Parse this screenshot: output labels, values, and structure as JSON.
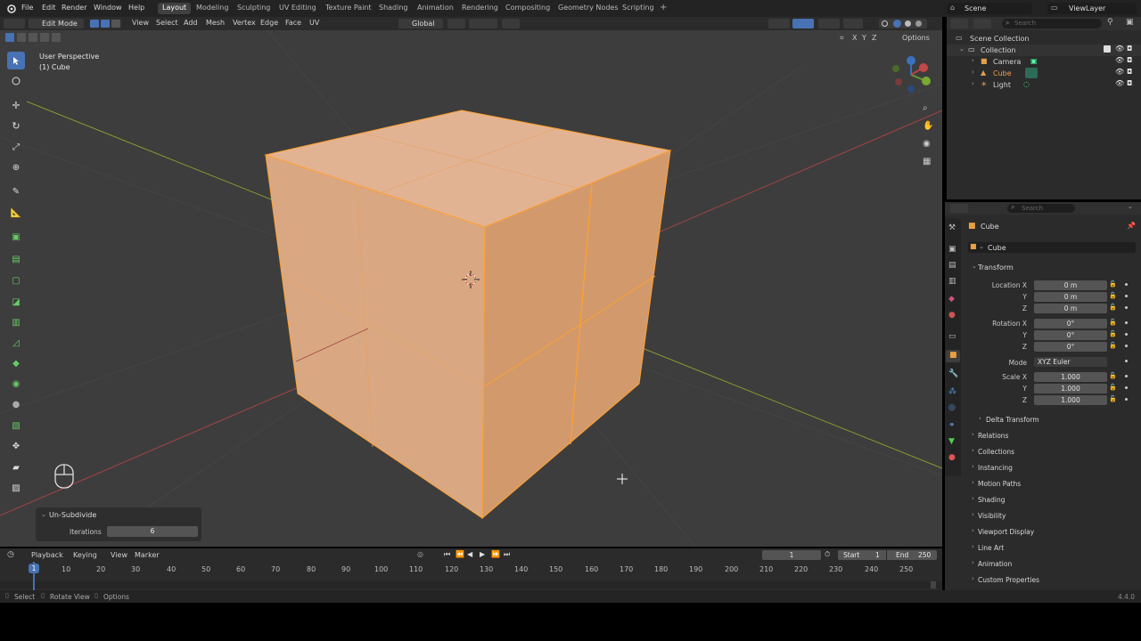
{
  "topbar": {
    "menus": [
      "File",
      "Edit",
      "Render",
      "Window",
      "Help"
    ],
    "workspaces": [
      "Layout",
      "Modeling",
      "Sculpting",
      "UV Editing",
      "Texture Paint",
      "Shading",
      "Animation",
      "Rendering",
      "Compositing",
      "Geometry Nodes",
      "Scripting"
    ],
    "active_workspace": "Layout",
    "scene": "Scene",
    "view_layer": "ViewLayer"
  },
  "viewport_header": {
    "mode": "Edit Mode",
    "menus": [
      "View",
      "Select",
      "Add",
      "Mesh",
      "Vertex",
      "Edge",
      "Face",
      "UV"
    ],
    "orientation": "Global",
    "options_label": "Options",
    "axes": [
      "X",
      "Y",
      "Z"
    ]
  },
  "viewport": {
    "view_name": "User Perspective",
    "object_label": "(1) Cube"
  },
  "last_operator": {
    "title": "Un-Subdivide",
    "iterations_label": "Iterations",
    "iterations_value": "6"
  },
  "outliner": {
    "search_placeholder": "Search",
    "items": [
      {
        "label": "Scene Collection"
      },
      {
        "label": "Collection"
      },
      {
        "label": "Camera"
      },
      {
        "label": "Cube"
      },
      {
        "label": "Light"
      }
    ]
  },
  "properties": {
    "search_placeholder": "Search",
    "object_name": "Cube",
    "datablock_name": "Cube",
    "transform_title": "Transform",
    "location_label": "Location X",
    "location": [
      "0 m",
      "0 m",
      "0 m"
    ],
    "rotation_label": "Rotation X",
    "rotation": [
      "0°",
      "0°",
      "0°"
    ],
    "mode_label": "Mode",
    "mode_value": "XYZ Euler",
    "scale_label": "Scale X",
    "scale": [
      "1.000",
      "1.000",
      "1.000"
    ],
    "y_label": "Y",
    "z_label": "Z",
    "delta_transform": "Delta Transform",
    "panels": [
      "Relations",
      "Collections",
      "Instancing",
      "Motion Paths",
      "Shading",
      "Visibility",
      "Viewport Display",
      "Line Art",
      "Animation",
      "Custom Properties"
    ]
  },
  "timeline": {
    "menus": [
      "Playback",
      "Keying",
      "View",
      "Marker"
    ],
    "current_frame": "1",
    "start_label": "Start",
    "start_value": "1",
    "end_label": "End",
    "end_value": "250",
    "frames": [
      "1",
      "10",
      "20",
      "30",
      "40",
      "50",
      "60",
      "70",
      "80",
      "90",
      "100",
      "110",
      "120",
      "130",
      "140",
      "150",
      "160",
      "170",
      "180",
      "190",
      "200",
      "210",
      "220",
      "230",
      "240",
      "250"
    ]
  },
  "statusbar": {
    "items": [
      "Select",
      "Rotate View",
      "Options"
    ],
    "version": "4.4.0"
  },
  "colors": {
    "accent": "#4772b3",
    "selection": "#ffa030",
    "mesh_face": "#e0a878"
  }
}
